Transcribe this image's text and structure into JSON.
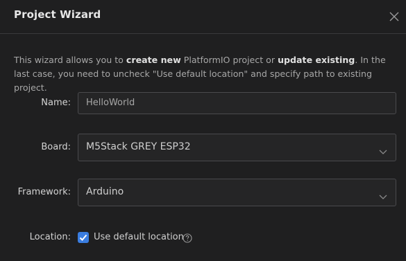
{
  "dialog": {
    "title": "Project Wizard",
    "close_icon": "close-icon"
  },
  "description": {
    "part1": "This wizard allows you to ",
    "bold1": "create new",
    "part2": " PlatformIO project or ",
    "bold2": "update existing",
    "part3": ". In the last case, you need to uncheck \"Use default location\" and specify path to existing project."
  },
  "form": {
    "name": {
      "label": "Name",
      "value": "HelloWorld"
    },
    "board": {
      "label": "Board",
      "value": "M5Stack GREY ESP32",
      "icon": "chevron-down-icon"
    },
    "framework": {
      "label": "Framework",
      "value": "Arduino",
      "icon": "chevron-down-icon"
    },
    "location": {
      "label": "Location",
      "checkbox_label": "Use default location",
      "checked": true,
      "help_icon": "question-circle-icon"
    }
  },
  "colors": {
    "accent": "#3a7de0",
    "background": "#1f1f20",
    "border": "#4a4a4d"
  }
}
